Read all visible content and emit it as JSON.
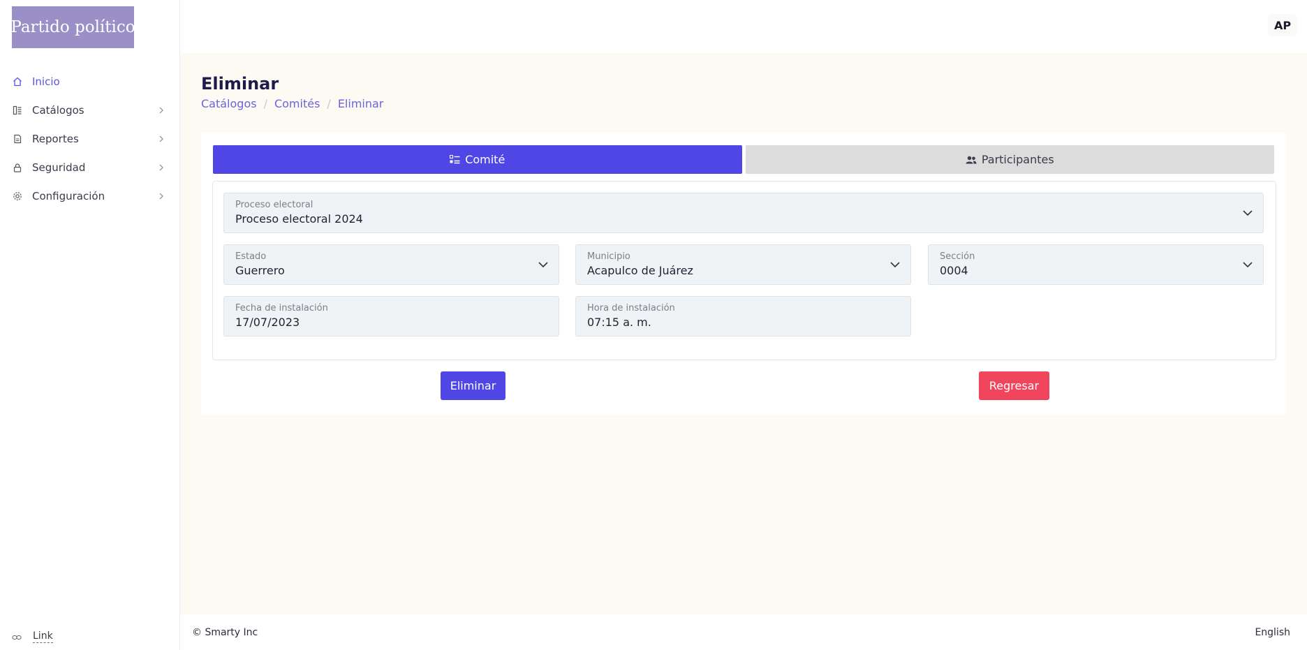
{
  "brand": {
    "logo_text": "Partido político"
  },
  "sidebar": {
    "items": [
      {
        "label": "Inicio",
        "icon": "home-icon",
        "active": true,
        "has_chevron": false
      },
      {
        "label": "Catálogos",
        "icon": "catalog-icon",
        "active": false,
        "has_chevron": true
      },
      {
        "label": "Reportes",
        "icon": "report-icon",
        "active": false,
        "has_chevron": true
      },
      {
        "label": "Seguridad",
        "icon": "lock-icon",
        "active": false,
        "has_chevron": true
      },
      {
        "label": "Configuración",
        "icon": "gear-icon",
        "active": false,
        "has_chevron": true
      }
    ],
    "footer_link": "Link"
  },
  "topbar": {
    "avatar_initials": "AP"
  },
  "page": {
    "title": "Eliminar",
    "breadcrumb": [
      "Catálogos",
      "Comités",
      "Eliminar"
    ]
  },
  "tabs": [
    {
      "label": "Comité",
      "icon": "list-icon",
      "active": true
    },
    {
      "label": "Participantes",
      "icon": "users-icon",
      "active": false
    }
  ],
  "form": {
    "proceso": {
      "label": "Proceso electoral",
      "value": "Proceso electoral 2024"
    },
    "estado": {
      "label": "Estado",
      "value": "Guerrero"
    },
    "municipio": {
      "label": "Municipio",
      "value": "Acapulco de Juárez"
    },
    "seccion": {
      "label": "Sección",
      "value": "0004"
    },
    "fecha": {
      "label": "Fecha de instalación",
      "value": "17/07/2023"
    },
    "hora": {
      "label": "Hora de instalación",
      "value": "07:15 a. m."
    }
  },
  "actions": {
    "delete_label": "Eliminar",
    "back_label": "Regresar"
  },
  "footer": {
    "copyright": "© Smarty Inc",
    "language": "English"
  },
  "colors": {
    "primary": "#4f46e5",
    "danger": "#f0455c",
    "logo_bg": "#9b8fc8",
    "link": "#6b63d9"
  }
}
